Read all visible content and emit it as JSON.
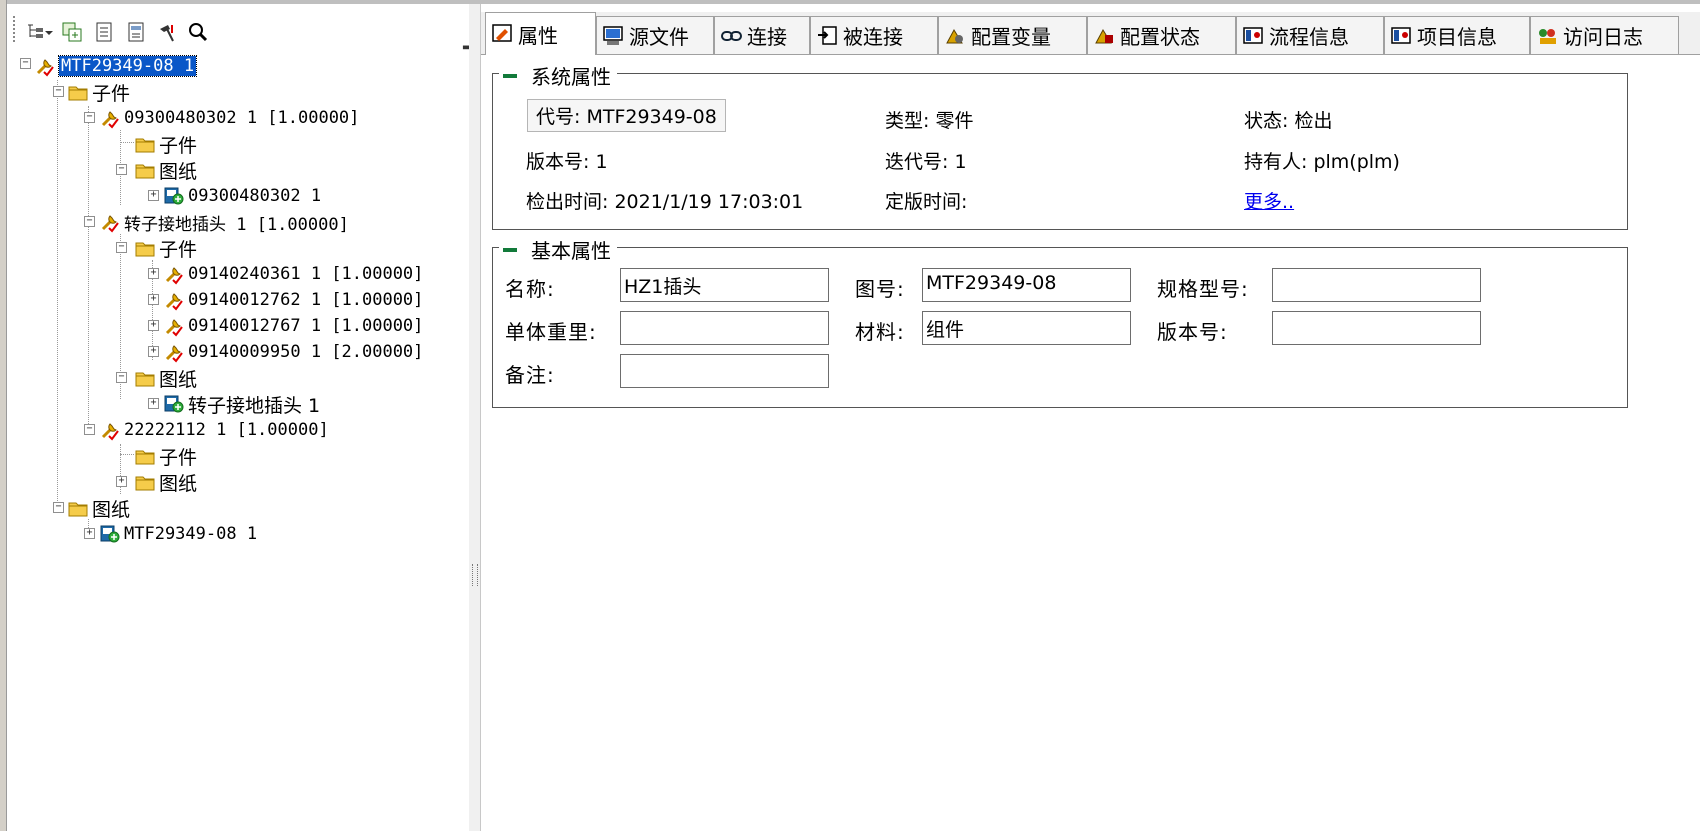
{
  "tree": {
    "root": {
      "label": "MTF29349-08 1"
    },
    "nodes": {
      "children1": "子件",
      "part1": "09300480302 1 [1.00000]",
      "part1_children": "子件",
      "part1_drawings": "图纸",
      "part1_doc": "09300480302 1",
      "part2": "转子接地插头 1 [1.00000]",
      "part2_children": "子件",
      "sub1": "09140240361 1 [1.00000]",
      "sub2": "09140012762 1 [1.00000]",
      "sub3": "09140012767 1 [1.00000]",
      "sub4": "09140009950 1 [2.00000]",
      "part2_drawings": "图纸",
      "part2_doc": "转子接地插头 1",
      "part3": "22222112 1 [1.00000]",
      "part3_children": "子件",
      "part3_drawings": "图纸",
      "drawings": "图纸",
      "root_doc": "MTF29349-08 1"
    }
  },
  "tabs": [
    {
      "label": "属性",
      "icon": "properties-icon"
    },
    {
      "label": "源文件",
      "icon": "source-file-icon"
    },
    {
      "label": "连接",
      "icon": "link-icon"
    },
    {
      "label": "被连接",
      "icon": "linked-by-icon"
    },
    {
      "label": "配置变量",
      "icon": "config-variable-icon"
    },
    {
      "label": "配置状态",
      "icon": "config-state-icon"
    },
    {
      "label": "流程信息",
      "icon": "workflow-info-icon"
    },
    {
      "label": "项目信息",
      "icon": "project-info-icon"
    },
    {
      "label": "访问日志",
      "icon": "access-log-icon"
    }
  ],
  "system": {
    "title": "系统属性",
    "code": "代号: MTF29349-08",
    "type": "类型: 零件",
    "status": "状态: 检出",
    "version": "版本号: 1",
    "iteration": "迭代号: 1",
    "holder": "持有人: plm(plm)",
    "checkout_time": "检出时间: 2021/1/19 17:03:01",
    "release_time": "定版时间:",
    "more": "更多.."
  },
  "basic": {
    "title": "基本属性",
    "name_label": "名称:",
    "name_value": "HZ1插头",
    "drawing_no_label": "图号:",
    "drawing_no_value": "MTF29349-08",
    "spec_label": "规格型号:",
    "spec_value": "",
    "weight_label": "单体重里:",
    "weight_value": "",
    "material_label": "材料:",
    "material_value": "组件",
    "version_label": "版本号:",
    "version_value": "",
    "remark_label": "备注:",
    "remark_value": ""
  },
  "colors": {
    "selection": "#0a57c8",
    "group_minus": "#127a3a",
    "link": "#0000ee"
  }
}
